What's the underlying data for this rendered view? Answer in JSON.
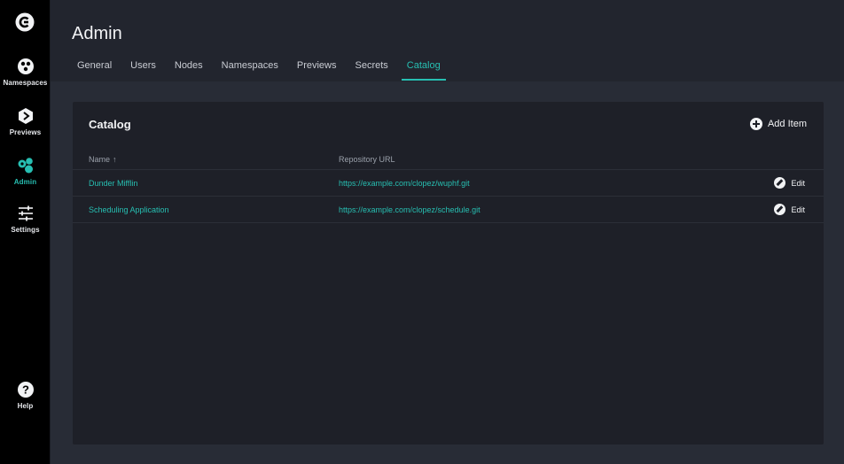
{
  "sidebar": {
    "logo_icon": "app-logo-icon",
    "items": [
      {
        "label": "Namespaces",
        "icon": "namespaces-icon",
        "active": false
      },
      {
        "label": "Previews",
        "icon": "previews-icon",
        "active": false
      },
      {
        "label": "Admin",
        "icon": "admin-icon",
        "active": true
      },
      {
        "label": "Settings",
        "icon": "settings-sliders-icon",
        "active": false
      }
    ],
    "help": {
      "label": "Help",
      "icon": "help-icon"
    }
  },
  "header": {
    "title": "Admin",
    "tabs": [
      {
        "label": "General",
        "active": false
      },
      {
        "label": "Users",
        "active": false
      },
      {
        "label": "Nodes",
        "active": false
      },
      {
        "label": "Namespaces",
        "active": false
      },
      {
        "label": "Previews",
        "active": false
      },
      {
        "label": "Secrets",
        "active": false
      },
      {
        "label": "Catalog",
        "active": true
      }
    ]
  },
  "catalog": {
    "title": "Catalog",
    "add_label": "Add Item",
    "columns": {
      "name": "Name",
      "url": "Repository URL"
    },
    "sort_icon": "arrow-up-icon",
    "rows": [
      {
        "name": "Dunder Mifflin",
        "url": "https://example.com/clopez/wuphf.git",
        "edit_label": "Edit"
      },
      {
        "name": "Scheduling Application",
        "url": "https://example.com/clopez/schedule.git",
        "edit_label": "Edit"
      }
    ]
  },
  "colors": {
    "accent": "#27bfb2",
    "sidebar_bg": "#000000",
    "header_bg": "#22252e",
    "page_bg": "#282c36",
    "card_bg": "#1e2028"
  }
}
